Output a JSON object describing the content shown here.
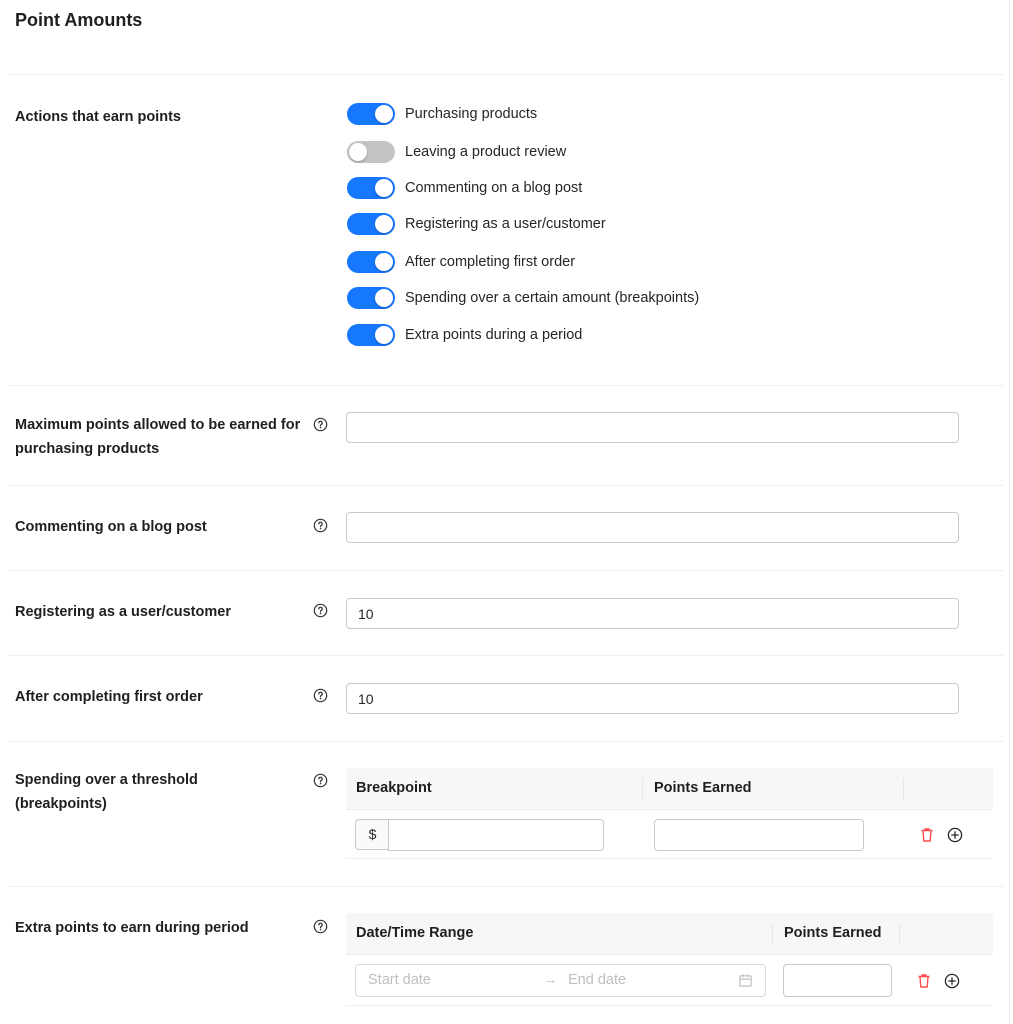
{
  "page": {
    "title": "Point Amounts"
  },
  "actions": {
    "label": "Actions that earn points",
    "toggles": [
      {
        "label": "Purchasing products",
        "on": true
      },
      {
        "label": "Leaving a product review",
        "on": false
      },
      {
        "label": "Commenting on a blog post",
        "on": true
      },
      {
        "label": "Registering as a user/customer",
        "on": true
      },
      {
        "label": "After completing first order",
        "on": true
      },
      {
        "label": "Spending over a certain amount (breakpoints)",
        "on": true
      },
      {
        "label": "Extra points during a period",
        "on": true
      }
    ]
  },
  "fields": {
    "max_points": {
      "label": "Maximum points allowed to be earned for purchasing products",
      "value": ""
    },
    "blog_comment": {
      "label": "Commenting on a blog post",
      "value": ""
    },
    "registering": {
      "label": "Registering as a user/customer",
      "value": "10"
    },
    "first_order": {
      "label": "After completing first order",
      "value": "10"
    }
  },
  "breakpoints": {
    "label": "Spending over a threshold (breakpoints)",
    "columns": [
      "Breakpoint",
      "Points Earned"
    ],
    "currency_prefix": "$",
    "rows": [
      {
        "breakpoint": "",
        "points": ""
      }
    ]
  },
  "period": {
    "label": "Extra points to earn during period",
    "columns": [
      "Date/Time Range",
      "Points Earned"
    ],
    "start_placeholder": "Start date",
    "end_placeholder": "End date",
    "range_separator": "→",
    "rows": [
      {
        "points": ""
      }
    ]
  },
  "colors": {
    "accent": "#1677ff",
    "toggle_off": "#c4c4c4",
    "delete": "#ff4d4f"
  },
  "icons": {
    "help": "question-circle-icon",
    "delete": "trash-icon",
    "add": "plus-circle-icon",
    "calendar": "calendar-icon"
  }
}
